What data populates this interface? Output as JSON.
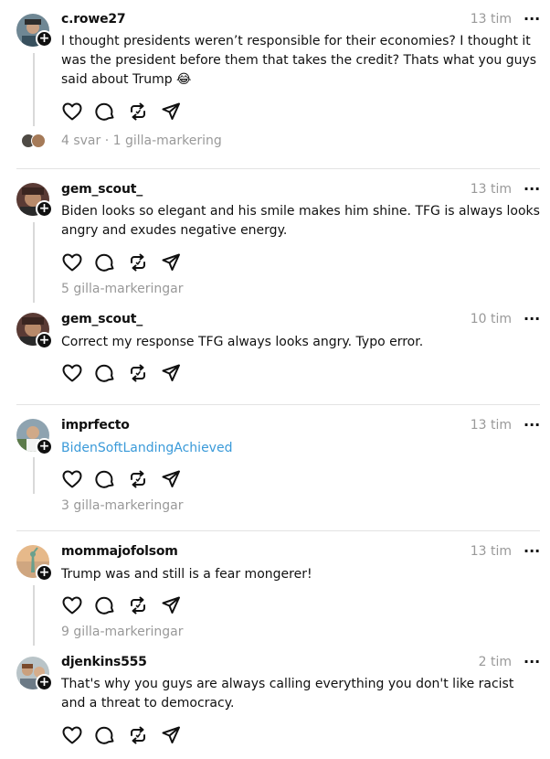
{
  "posts": [
    {
      "username": "c.rowe27",
      "time": "13 tim",
      "more_label": "···",
      "text": "I thought presidents weren’t responsible for their economies? I thought it was the president before them that takes the credit? Thats what you guys said about Trump 😂",
      "meta": "4 svar · 1 gilla-markering"
    },
    {
      "username": "gem_scout_",
      "time": "13 tim",
      "more_label": "···",
      "text": "Biden looks so elegant and his smile makes him shine. TFG is always looks angry and exudes negative energy.",
      "meta": "5 gilla-markeringar"
    },
    {
      "username": "gem_scout_",
      "time": "10 tim",
      "more_label": "···",
      "text": "Correct my response TFG always looks angry. Typo error.",
      "meta": ""
    },
    {
      "username": "imprfecto",
      "time": "13 tim",
      "more_label": "···",
      "text": "BidenSoftLandingAchieved",
      "meta": "3 gilla-markeringar"
    },
    {
      "username": "mommajofolsom",
      "time": "13 tim",
      "more_label": "···",
      "text": "Trump was and still is a fear mongerer!",
      "meta": "9 gilla-markeringar"
    },
    {
      "username": "djenkins555",
      "time": "2 tim",
      "more_label": "···",
      "text": "That's why you guys are always calling everything you don't like racist and a threat to democracy.",
      "meta": ""
    }
  ],
  "icons": {
    "follow": "plus-icon",
    "like": "heart-icon",
    "reply": "comment-icon",
    "repost": "repost-icon",
    "share": "send-icon"
  },
  "colors": {
    "link": "#3a9ad9",
    "muted": "#999999",
    "divider": "#e3e3e3"
  }
}
